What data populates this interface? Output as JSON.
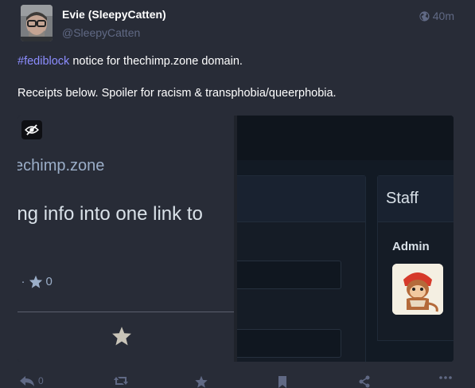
{
  "author": {
    "display_name": "Evie (SleepyCatten)",
    "handle": "@SleepyCatten"
  },
  "meta": {
    "visibility_icon": "globe-icon",
    "time": "40m"
  },
  "content": {
    "hashtag": "#fediblock",
    "line1_rest": " notice for thechimp.zone domain.",
    "line2": "Receipts below. Spoiler for racism & transphobia/queerphobia."
  },
  "media": {
    "hide_icon": "eye-slash-icon",
    "left_crop": {
      "domain": "echimp.zone",
      "title": "ing info into one link to",
      "counts_prefix": "0 ·",
      "star_count": "0"
    },
    "right_crop": {
      "staff_title": "Staff",
      "admin_label": "Admin"
    }
  },
  "actions": {
    "reply_count": "0",
    "icons": [
      "reply-icon",
      "boost-icon",
      "favourite-icon",
      "bookmark-icon",
      "share-icon",
      "more-icon"
    ]
  },
  "colors": {
    "background": "#282c37",
    "hashtag": "#8c8dff",
    "muted": "#606984"
  }
}
